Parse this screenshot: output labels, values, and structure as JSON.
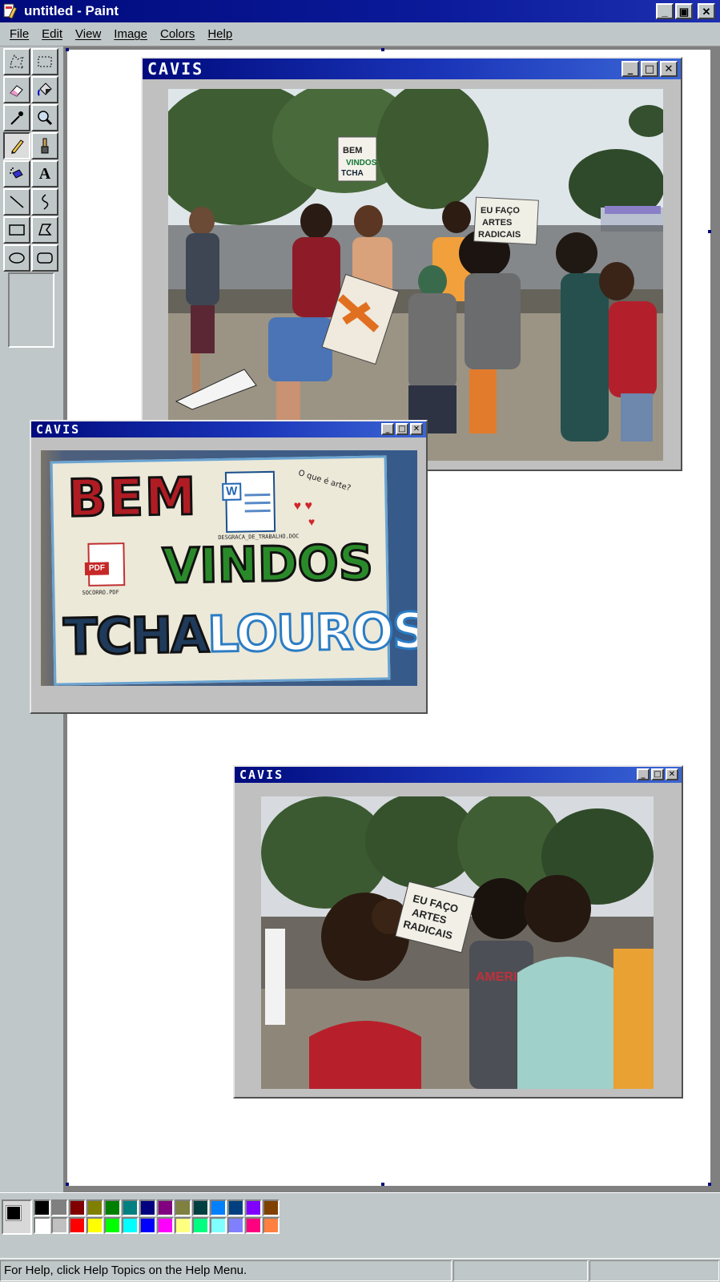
{
  "titlebar": {
    "title": "untitled - Paint",
    "minimize": "_",
    "maximize": "▣",
    "close": "✕"
  },
  "menu": [
    "File",
    "Edit",
    "View",
    "Image",
    "Colors",
    "Help"
  ],
  "tools": [
    {
      "name": "free-form-select-icon"
    },
    {
      "name": "rect-select-icon"
    },
    {
      "name": "eraser-icon"
    },
    {
      "name": "fill-icon"
    },
    {
      "name": "color-picker-icon"
    },
    {
      "name": "magnifier-icon"
    },
    {
      "name": "pencil-icon",
      "active": true
    },
    {
      "name": "brush-icon"
    },
    {
      "name": "airbrush-icon"
    },
    {
      "name": "text-icon",
      "glyph": "A"
    },
    {
      "name": "line-icon"
    },
    {
      "name": "curve-icon"
    },
    {
      "name": "rectangle-icon"
    },
    {
      "name": "polygon-icon"
    },
    {
      "name": "ellipse-icon"
    },
    {
      "name": "rounded-rect-icon"
    }
  ],
  "windows": [
    {
      "title": "CAVIS",
      "photo": "group-photo-protest-signs"
    },
    {
      "title": "CAVIS",
      "photo": "welcome-sign-photo",
      "sign": {
        "line1": "BEM",
        "line2": "VINDOS",
        "line3a": "TCHA",
        "line3b": "LOUROS",
        "note": "O que é arte?",
        "doc_label": "DESGRACA_DE_TRABALHO.DOC",
        "pdf_label": "SOCORRO.PDF",
        "pdf_badge": "PDF",
        "doc_badge": "W"
      }
    },
    {
      "title": "CAVIS",
      "photo": "crowd-photo-sign",
      "sign_text": "EU FAÇO ARTES RADICAIS"
    }
  ],
  "photo1_signs": {
    "left": "BEM VINDOS TCHA",
    "right": "EU FAÇO ARTES RADICAIS"
  },
  "palette": {
    "colors": [
      "#000000",
      "#808080",
      "#800000",
      "#808000",
      "#008000",
      "#008080",
      "#000080",
      "#800080",
      "#808040",
      "#004040",
      "#0080ff",
      "#004080",
      "#8000ff",
      "#804000",
      "#ffffff",
      "#c0c0c0",
      "#ff0000",
      "#ffff00",
      "#00ff00",
      "#00ffff",
      "#0000ff",
      "#ff00ff",
      "#ffff80",
      "#00ff80",
      "#80ffff",
      "#8080ff",
      "#ff0080",
      "#ff8040"
    ],
    "foreground": "#000000",
    "background": "#ffffff"
  },
  "status": {
    "text": "For Help, click Help Topics on the Help Menu."
  }
}
